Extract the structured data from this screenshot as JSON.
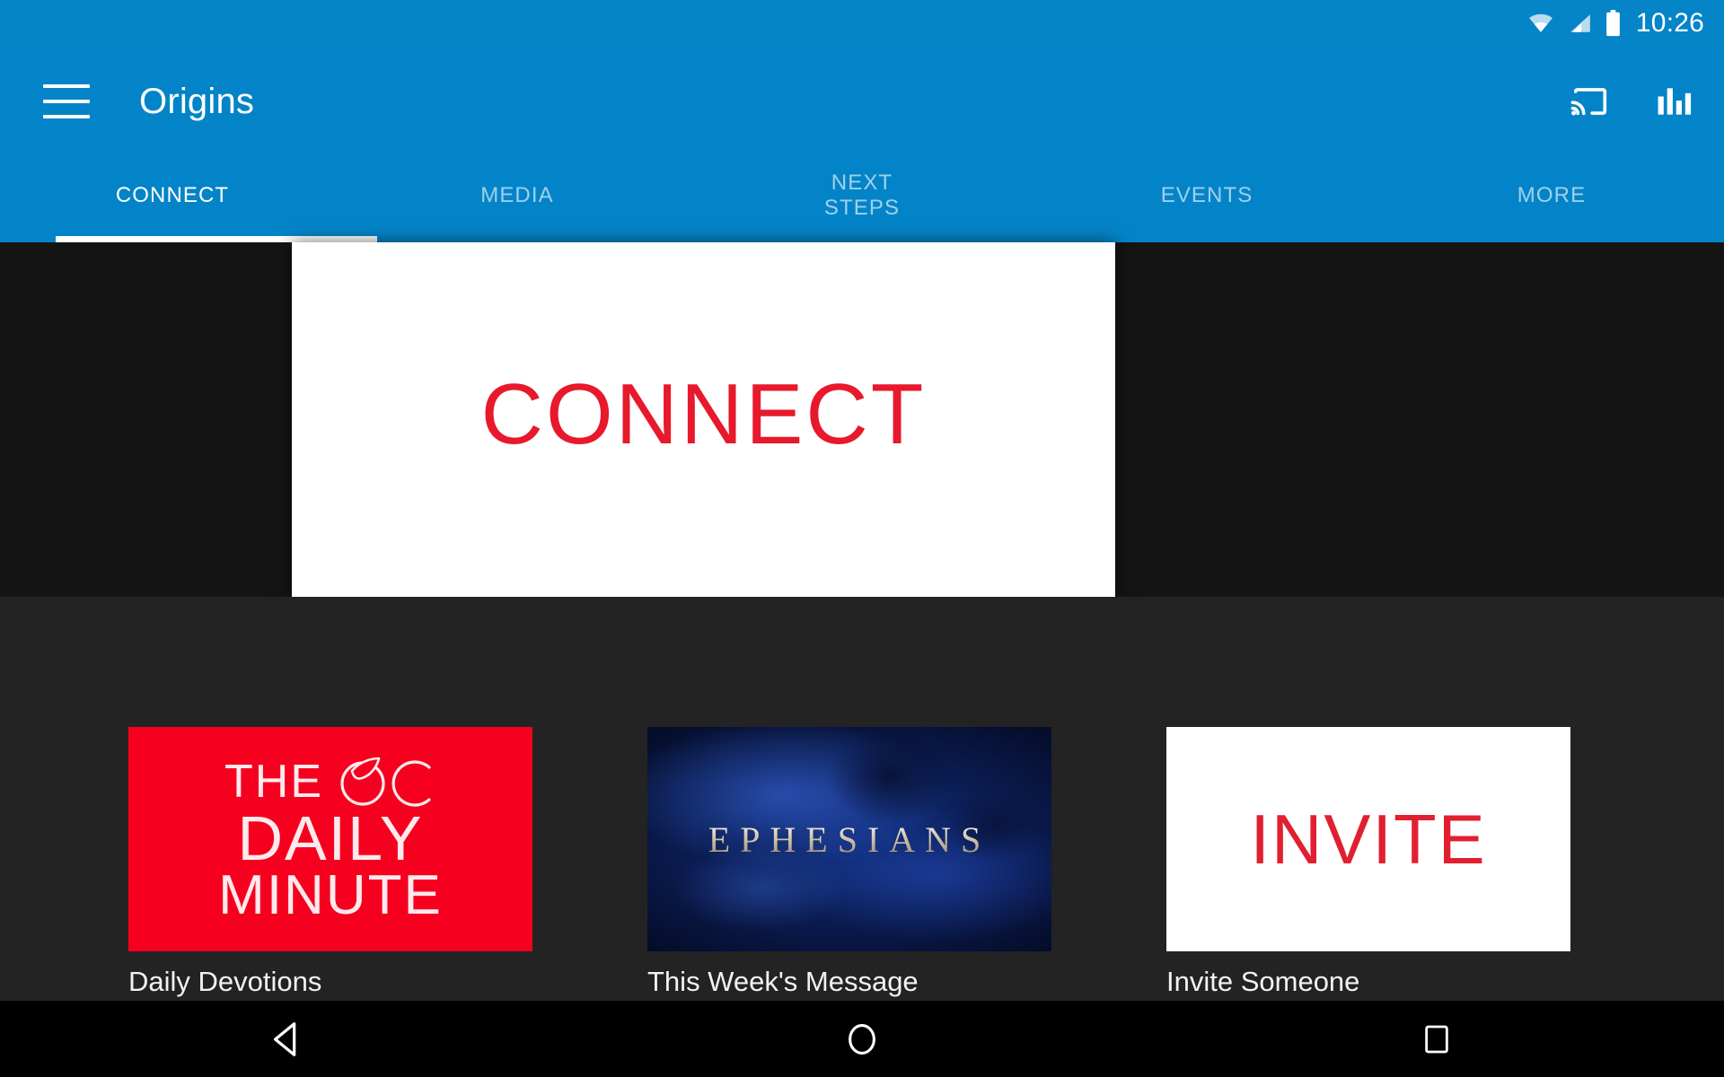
{
  "status_bar": {
    "time": "10:26",
    "icons": [
      "wifi-icon",
      "cellular-signal-icon",
      "battery-icon"
    ]
  },
  "app_bar": {
    "title": "Origins",
    "menu_icon": "hamburger-menu-icon",
    "actions": [
      {
        "name": "cast-icon",
        "label": "Cast"
      },
      {
        "name": "equalizer-icon",
        "label": "Stats"
      }
    ],
    "background_color": "#0484c8"
  },
  "tabs": {
    "items": [
      {
        "label": "CONNECT",
        "active": true
      },
      {
        "label": "MEDIA",
        "active": false
      },
      {
        "label": "NEXT\nSTEPS",
        "active": false
      },
      {
        "label": "EVENTS",
        "active": false
      },
      {
        "label": "MORE",
        "active": false
      }
    ],
    "active_index": 0,
    "indicator_color": "#ffffff"
  },
  "hero": {
    "text": "CONNECT",
    "text_color": "#e8192c",
    "background_color": "#ffffff"
  },
  "content": {
    "background_color": "#232323",
    "cards": [
      {
        "label": "Daily Devotions",
        "thumb_kind": "oc-daily-minute",
        "thumb_line1": "THE",
        "thumb_mark": "OC",
        "thumb_line2": "DAILY",
        "thumb_line3": "MINUTE",
        "thumb_bg": "#f5001e"
      },
      {
        "label": "This Week's Message",
        "thumb_kind": "ephesians",
        "thumb_title": "EPHESIANS",
        "thumb_bg": "#0a1a4d"
      },
      {
        "label": "Invite Someone",
        "thumb_kind": "invite",
        "thumb_title": "INVITE",
        "thumb_bg": "#ffffff"
      }
    ]
  },
  "nav_bar": {
    "buttons": [
      {
        "name": "back-button",
        "label": "Back"
      },
      {
        "name": "home-button",
        "label": "Home"
      },
      {
        "name": "recents-button",
        "label": "Recents"
      }
    ],
    "background_color": "#000000"
  }
}
